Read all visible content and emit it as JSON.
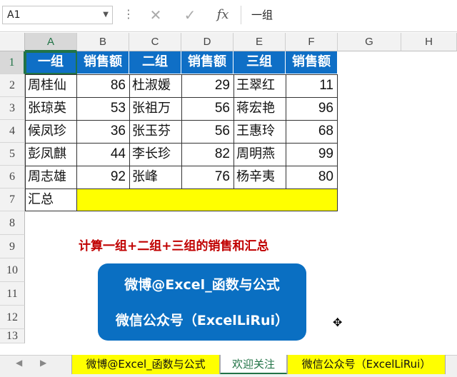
{
  "namebox": {
    "value": "A1"
  },
  "formula_bar": {
    "cancel": "✕",
    "enter": "✓",
    "fx": "fx",
    "value": "一组"
  },
  "columns": [
    "A",
    "B",
    "C",
    "D",
    "E",
    "F",
    "G",
    "H"
  ],
  "rows": [
    "1",
    "2",
    "3",
    "4",
    "5",
    "6",
    "7",
    "8",
    "9",
    "10",
    "11",
    "12",
    "13"
  ],
  "table": {
    "headers": [
      "一组",
      "销售额",
      "二组",
      "销售额",
      "三组",
      "销售额"
    ],
    "data": [
      [
        "周桂仙",
        "86",
        "杜淑媛",
        "29",
        "王翠红",
        "11"
      ],
      [
        "张琼英",
        "53",
        "张祖万",
        "56",
        "蒋宏艳",
        "96"
      ],
      [
        "候凤珍",
        "36",
        "张玉芬",
        "56",
        "王惠玲",
        "68"
      ],
      [
        "彭凤麒",
        "44",
        "李长珍",
        "82",
        "周明燕",
        "99"
      ],
      [
        "周志雄",
        "92",
        "张峰",
        "76",
        "杨辛夷",
        "80"
      ]
    ],
    "summary_label": "汇总"
  },
  "note": "计算一组+二组+三组的销售和汇总",
  "promo": {
    "line1": "微博@Excel_函数与公式",
    "line2": "微信公众号（ExcelLiRui）"
  },
  "cursor": "✥",
  "sheet_tabs": [
    "微博@Excel_函数与公式",
    "欢迎关注",
    "微信公众号（ExcelLiRui）"
  ],
  "nav": {
    "prev": "◀",
    "next": "▶"
  },
  "colors": {
    "header_blue": "#0f6fc6",
    "summary_yellow": "#ffff00",
    "note_red": "#c00000",
    "excel_green": "#217346"
  }
}
